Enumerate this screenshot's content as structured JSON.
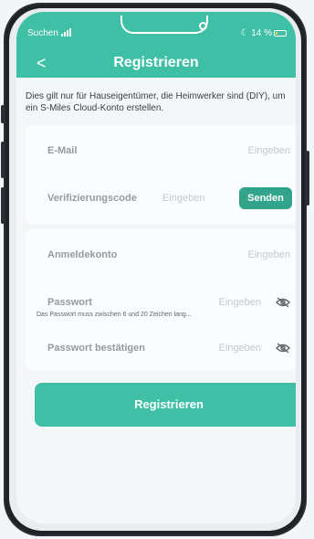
{
  "status_bar": {
    "carrier": "Suchen",
    "battery": "14 %"
  },
  "nav": {
    "back_glyph": "<",
    "title": "Registrieren"
  },
  "notice": "Dies gilt nur für Hauseigentümer, die Heimwerker sind (DIY), um ein S-Miles Cloud-Konto erstellen.",
  "form": {
    "email": {
      "label": "E-Mail",
      "placeholder": "Eingeben"
    },
    "code": {
      "label": "Verifizierungscode",
      "placeholder": "Eingeben",
      "send_label": "Senden"
    },
    "account": {
      "label": "Anmeldekonto",
      "placeholder": "Eingeben"
    },
    "password": {
      "label": "Passwort",
      "placeholder": "Eingeben",
      "hint": "Das Passwort muss zwischen 6 und 20 Zeichen lang..."
    },
    "confirm": {
      "label": "Passwort bestätigen",
      "placeholder": "Eingeben"
    }
  },
  "submit_label": "Registrieren",
  "colors": {
    "primary": "#3fbfa6",
    "send_button": "#31a48b"
  },
  "icons": {
    "back": "chevron-left-icon",
    "password_visibility": "eye-off-icon"
  }
}
